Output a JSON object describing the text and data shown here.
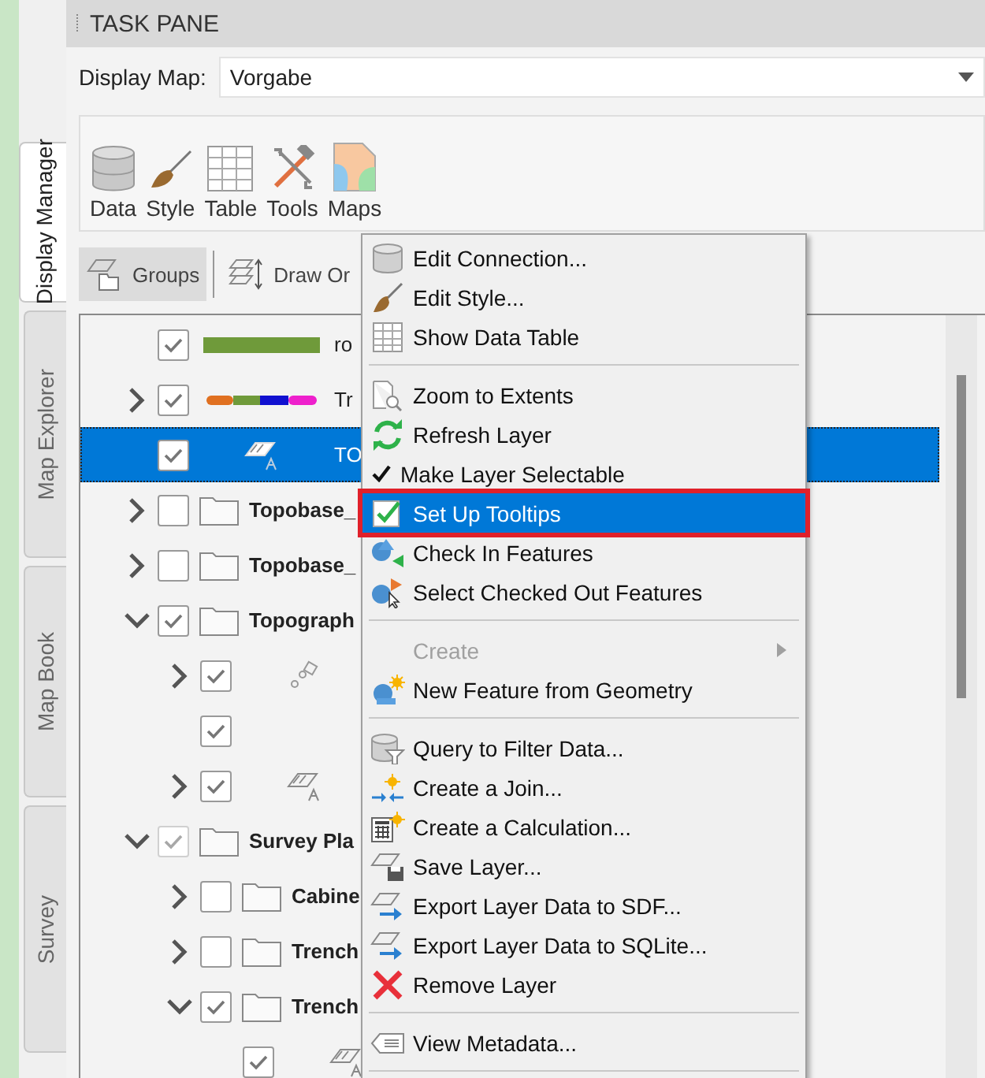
{
  "side_tabs": [
    {
      "label": "Display Manager",
      "selected": true
    },
    {
      "label": "Map Explorer",
      "selected": false
    },
    {
      "label": "Map Book",
      "selected": false
    },
    {
      "label": "Survey",
      "selected": false
    }
  ],
  "task_pane": {
    "title": "TASK PANE",
    "display_map": {
      "label": "Display Map:",
      "value": "Vorgabe"
    }
  },
  "toolbar": [
    "Data",
    "Style",
    "Table",
    "Tools",
    "Maps"
  ],
  "view_buttons": [
    {
      "label": "Groups",
      "selected": true
    },
    {
      "label": "Draw Or",
      "selected": false
    }
  ],
  "tree": [
    {
      "kind": "line",
      "label": "ro",
      "checked": true,
      "disabled": false,
      "selected": false
    },
    {
      "kind": "theme-line",
      "label": "Tr",
      "checked": true,
      "disabled": false,
      "selected": false,
      "expanded": false
    },
    {
      "kind": "label-layer",
      "label": "TO",
      "checked": true,
      "disabled": false,
      "selected": true
    },
    {
      "kind": "group",
      "label": "Topobase_",
      "checked": false,
      "disabled": false,
      "selected": false,
      "expanded": false
    },
    {
      "kind": "group",
      "label": "Topobase_",
      "checked": false,
      "disabled": false,
      "selected": false,
      "expanded": false
    },
    {
      "kind": "group",
      "label": "Topograph",
      "checked": true,
      "disabled": false,
      "selected": false,
      "expanded": true,
      "children": [
        {
          "kind": "point-layer",
          "checked": true,
          "disabled": false,
          "selected": false,
          "expanded": false
        },
        {
          "kind": "blank",
          "checked": true,
          "disabled": false,
          "selected": false
        },
        {
          "kind": "label-layer",
          "checked": true,
          "disabled": false,
          "selected": false,
          "expanded": false
        }
      ]
    },
    {
      "kind": "group",
      "label": "Survey Pla",
      "checked": true,
      "disabled": true,
      "selected": false,
      "expanded": true,
      "children": [
        {
          "kind": "group",
          "label": "Cabine",
          "checked": false,
          "disabled": false,
          "selected": false,
          "expanded": false
        },
        {
          "kind": "group",
          "label": "Trench",
          "checked": false,
          "disabled": false,
          "selected": false,
          "expanded": false
        },
        {
          "kind": "group",
          "label": "Trench",
          "checked": true,
          "disabled": false,
          "selected": false,
          "expanded": true,
          "children": [
            {
              "kind": "label-layer",
              "checked": true,
              "disabled": false,
              "selected": false
            }
          ]
        }
      ]
    }
  ],
  "context_menu": [
    {
      "kind": "item",
      "label": "Edit Connection...",
      "selected": false,
      "disabled": false
    },
    {
      "kind": "item",
      "label": "Edit Style...",
      "selected": false,
      "disabled": false
    },
    {
      "kind": "item",
      "label": "Show Data Table",
      "selected": false,
      "disabled": false
    },
    {
      "kind": "separator"
    },
    {
      "kind": "item",
      "label": "Zoom to Extents",
      "selected": false,
      "disabled": false
    },
    {
      "kind": "item",
      "label": "Refresh Layer",
      "selected": false,
      "disabled": false
    },
    {
      "kind": "check",
      "label": "Make Layer Selectable",
      "checked": true,
      "selected": false,
      "disabled": false
    },
    {
      "kind": "item",
      "label": "Set Up Tooltips",
      "selected": true,
      "disabled": false
    },
    {
      "kind": "item",
      "label": "Check In Features",
      "selected": false,
      "disabled": false
    },
    {
      "kind": "item",
      "label": "Select Checked Out Features",
      "selected": false,
      "disabled": false
    },
    {
      "kind": "separator"
    },
    {
      "kind": "submenu",
      "label": "Create",
      "selected": false,
      "disabled": true
    },
    {
      "kind": "item",
      "label": "New Feature from Geometry",
      "selected": false,
      "disabled": false
    },
    {
      "kind": "separator"
    },
    {
      "kind": "item",
      "label": "Query to Filter Data...",
      "selected": false,
      "disabled": false
    },
    {
      "kind": "item",
      "label": "Create a Join...",
      "selected": false,
      "disabled": false
    },
    {
      "kind": "item",
      "label": "Create a Calculation...",
      "selected": false,
      "disabled": false
    },
    {
      "kind": "item",
      "label": "Save Layer...",
      "selected": false,
      "disabled": false
    },
    {
      "kind": "item",
      "label": "Export Layer Data to SDF...",
      "selected": false,
      "disabled": false
    },
    {
      "kind": "item",
      "label": "Export Layer Data to SQLite...",
      "selected": false,
      "disabled": false
    },
    {
      "kind": "item",
      "label": "Remove Layer",
      "selected": false,
      "disabled": false
    },
    {
      "kind": "separator"
    },
    {
      "kind": "item",
      "label": "View Metadata...",
      "selected": false,
      "disabled": false
    },
    {
      "kind": "separator"
    }
  ]
}
